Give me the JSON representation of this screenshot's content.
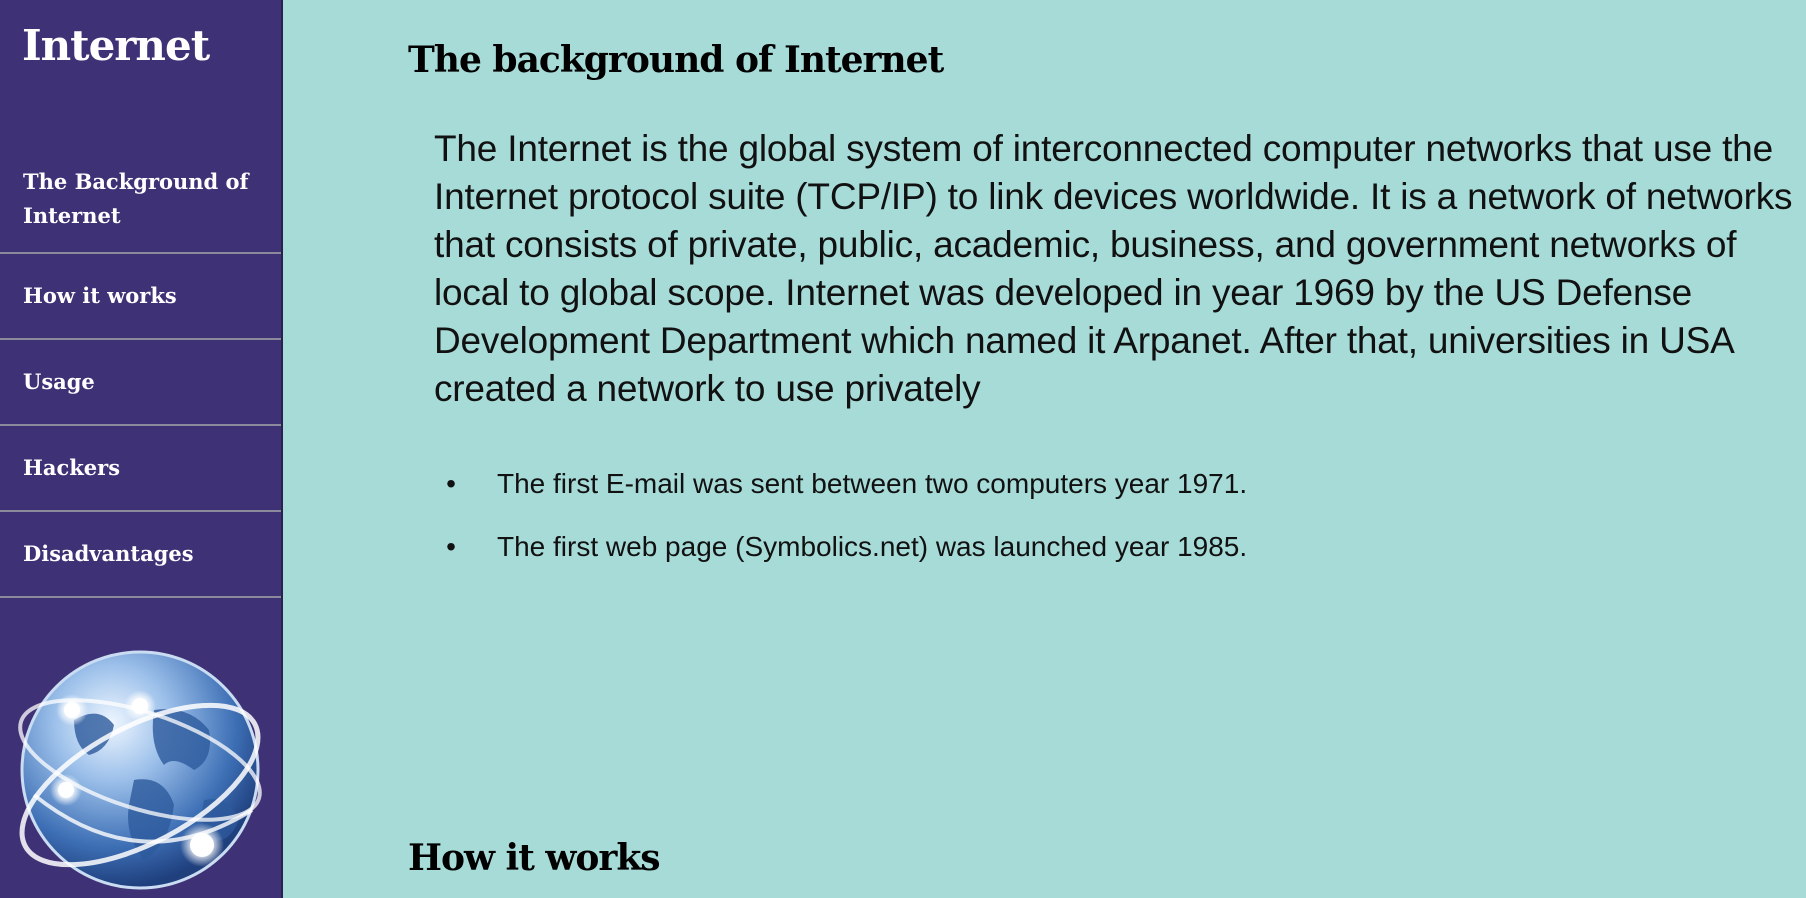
{
  "sidebar": {
    "title": "Internet",
    "nav": [
      {
        "label": "The Background of Internet"
      },
      {
        "label": "How it works"
      },
      {
        "label": "Usage"
      },
      {
        "label": "Hackers"
      },
      {
        "label": "Disadvantages"
      }
    ],
    "logo_icon": "globe-network-icon"
  },
  "main": {
    "sections": [
      {
        "title": "The background of Internet",
        "paragraph": "The Internet is the global system of interconnected computer networks that use the Internet protocol suite (TCP/IP) to link devices worldwide. It is a network of networks that consists of private, public, academic, business, and government networks of local to global scope. Internet was developed in year 1969 by the US Defense Development Department which named it Arpanet. After that, universities in USA created a network to use privately",
        "bullets": [
          "The first E-mail was sent between two computers year 1971.",
          "The first web page (Symbolics.net) was launched year 1985."
        ]
      },
      {
        "title": "How it works"
      }
    ]
  },
  "colors": {
    "sidebar_bg": "#3f3176",
    "main_bg": "#a6dbd8",
    "divider": "#8a8a9a",
    "text_light": "#ffffff",
    "text_dark": "#111111"
  }
}
